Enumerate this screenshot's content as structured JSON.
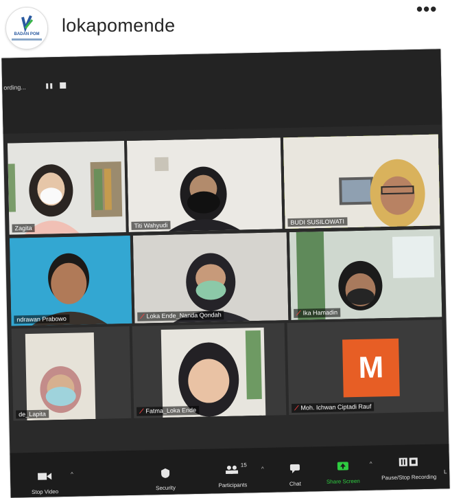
{
  "post": {
    "username": "lokapomende",
    "avatar_brand": "BADAN POM",
    "more_glyph": "•••"
  },
  "zoom": {
    "recording_text": "ording...",
    "participants": [
      {
        "name": "Zagita",
        "muted": false
      },
      {
        "name": "Titi Wahyudi",
        "muted": false
      },
      {
        "name": "BUDI SUSILOWATI",
        "muted": false,
        "active_speaker": true
      },
      {
        "name": "ndrawan Prabowo",
        "muted": false
      },
      {
        "name": "Loka Ende_Nanda Qondah",
        "muted": true
      },
      {
        "name": "Ika Hamadin",
        "muted": true
      },
      {
        "name": "de_Lapita",
        "muted": false
      },
      {
        "name": "Fatma_Loka Ende",
        "muted": true
      },
      {
        "name": "Moh. Ichwan Ciptadi Rauf",
        "muted": true,
        "avatar_letter": "M",
        "avatar_color": "#e75e25"
      }
    ],
    "toolbar": {
      "stop_video": "Stop Video",
      "security": "Security",
      "participants": "Participants",
      "participants_count": "15",
      "chat": "Chat",
      "share_screen": "Share Screen",
      "pause_recording": "Pause/Stop Recording",
      "overflow": "L"
    }
  },
  "colors": {
    "active_speaker_border": "#cfe84a",
    "share_green": "#2ecc40",
    "muted_red": "#ff4040"
  }
}
